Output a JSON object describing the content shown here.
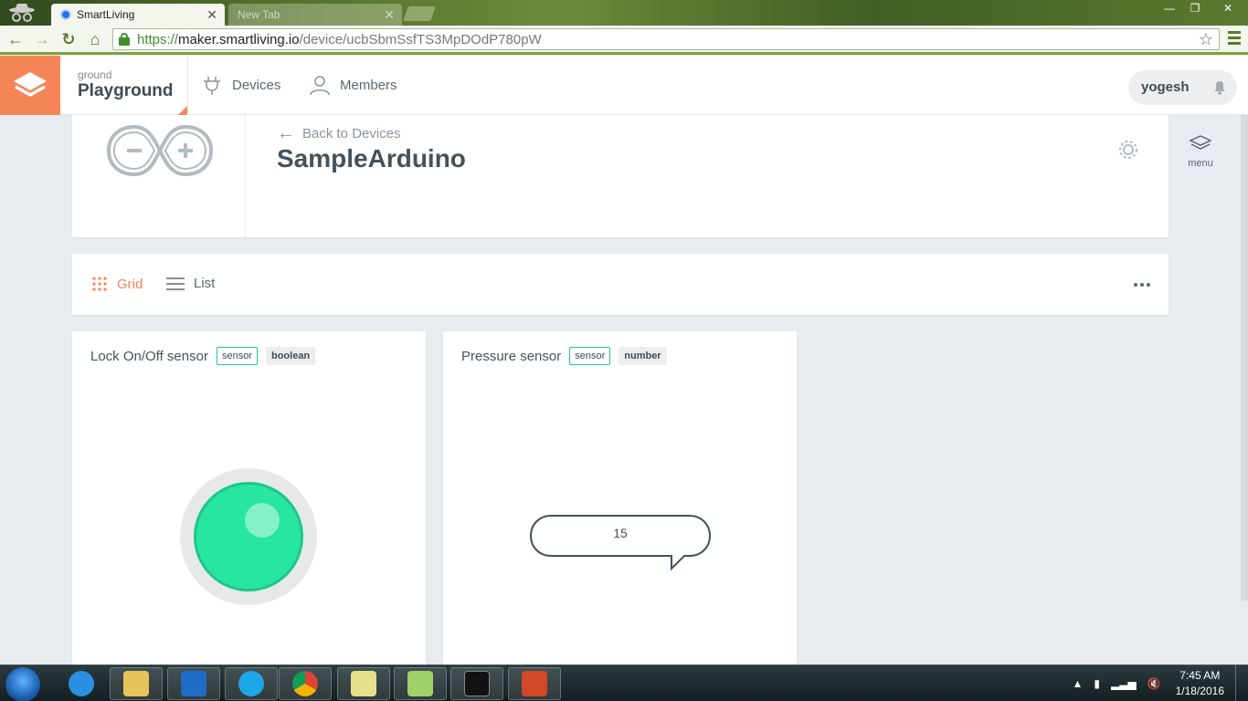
{
  "browser": {
    "tabs": [
      {
        "label": "SmartLiving",
        "active": true
      },
      {
        "label": "New Tab",
        "active": false
      }
    ],
    "url_scheme": "https://",
    "url_host": "maker.smartliving.io",
    "url_path": "/device/ucbSbmSsfTS3MpDOdP780pW",
    "window_buttons": [
      "minimize",
      "restore",
      "close"
    ]
  },
  "header": {
    "ground_label": "ground",
    "ground_name": "Playground",
    "nav": [
      {
        "label": "Devices",
        "icon": "plug-icon"
      },
      {
        "label": "Members",
        "icon": "person-icon"
      }
    ],
    "username": "yogesh",
    "colors": {
      "brand": "#f58456"
    }
  },
  "device": {
    "back_label": "Back to Devices",
    "name": "SampleArduino"
  },
  "side_menu": {
    "label": "menu"
  },
  "view": {
    "grid_label": "Grid",
    "list_label": "List",
    "active": "grid"
  },
  "sensors": [
    {
      "name": "Lock On/Off sensor",
      "kind_tag": "sensor",
      "type_tag": "boolean",
      "state": true,
      "color": "#27e6a0"
    },
    {
      "name": "Pressure sensor",
      "kind_tag": "sensor",
      "type_tag": "number",
      "value": "15"
    }
  ],
  "taskbar": {
    "apps": [
      "internet-explorer",
      "file-explorer",
      "outlook",
      "skype",
      "chrome",
      "sticky-notes",
      "notepad-plus-plus",
      "command-prompt",
      "powerpoint"
    ],
    "time": "7:45 AM",
    "date": "1/18/2016"
  }
}
